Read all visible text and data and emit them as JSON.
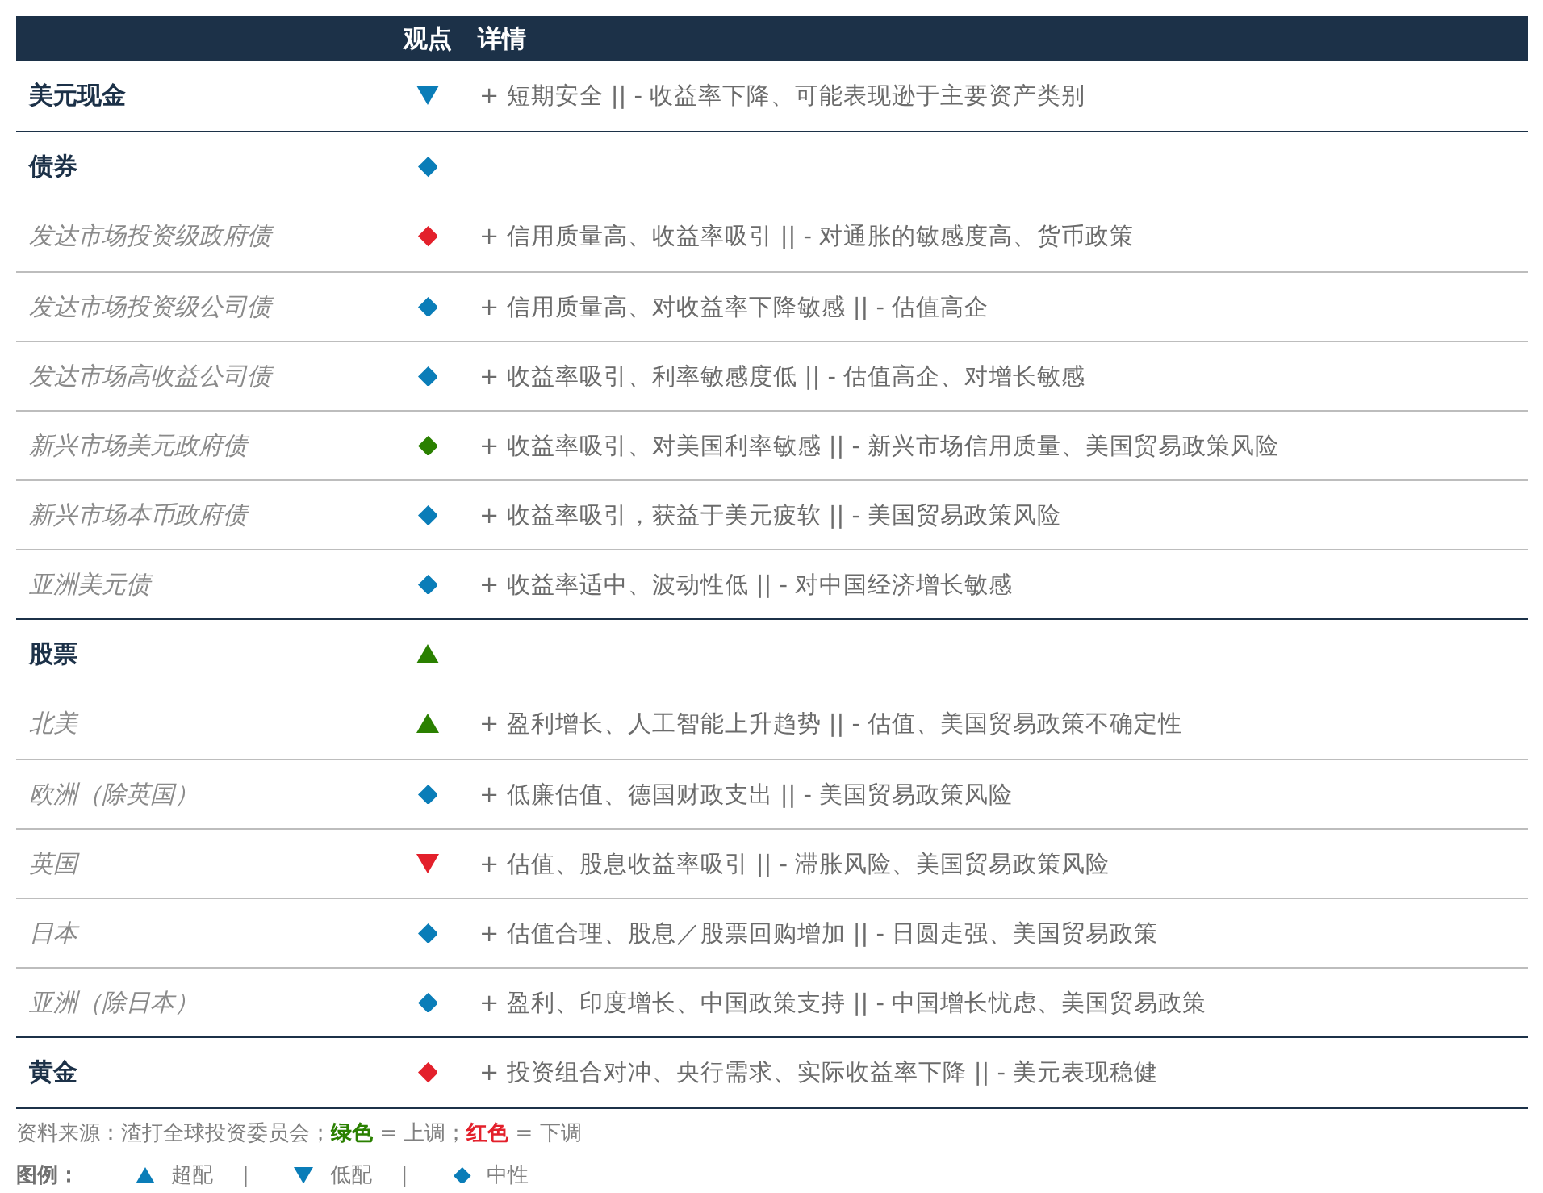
{
  "header": {
    "column_2": "观点",
    "column_3": "详情"
  },
  "sections": [
    {
      "name": "美元现金",
      "view": {
        "kind": "down",
        "color": "#0a7db8"
      },
      "details": "+ 短期安全 || - 收益率下降、可能表现逊于主要资产类别"
    },
    {
      "name": "债券",
      "view": {
        "kind": "diamond",
        "color": "#0a7db8"
      },
      "items": [
        {
          "name": "发达市场投资级政府债",
          "view": {
            "kind": "diamond",
            "color": "#e3202b"
          },
          "details": "+ 信用质量高、收益率吸引 || - 对通胀的敏感度高、货币政策"
        },
        {
          "name": "发达市场投资级公司债",
          "view": {
            "kind": "diamond",
            "color": "#0a7db8"
          },
          "details": "+ 信用质量高、对收益率下降敏感 || - 估值高企"
        },
        {
          "name": "发达市场高收益公司债",
          "view": {
            "kind": "diamond",
            "color": "#0a7db8"
          },
          "details": "+ 收益率吸引、利率敏感度低 || - 估值高企、对增长敏感"
        },
        {
          "name": "新兴市场美元政府债",
          "view": {
            "kind": "diamond",
            "color": "#2a8000"
          },
          "details": "+ 收益率吸引、对美国利率敏感 || - 新兴市场信用质量、美国贸易政策风险"
        },
        {
          "name": "新兴市场本币政府债",
          "view": {
            "kind": "diamond",
            "color": "#0a7db8"
          },
          "details": "+ 收益率吸引，获益于美元疲软 || - 美国贸易政策风险"
        },
        {
          "name": "亚洲美元债",
          "view": {
            "kind": "diamond",
            "color": "#0a7db8"
          },
          "details": "+ 收益率适中、波动性低 || - 对中国经济增长敏感"
        }
      ]
    },
    {
      "name": "股票",
      "view": {
        "kind": "up",
        "color": "#2a8000"
      },
      "items": [
        {
          "name": "北美",
          "view": {
            "kind": "up",
            "color": "#2a8000"
          },
          "details": "+ 盈利增长、人工智能上升趋势 || - 估值、美国贸易政策不确定性"
        },
        {
          "name": "欧洲（除英国）",
          "view": {
            "kind": "diamond",
            "color": "#0a7db8"
          },
          "details": "+ 低廉估值、德国财政支出 || - 美国贸易政策风险"
        },
        {
          "name": "英国",
          "view": {
            "kind": "down",
            "color": "#e3202b"
          },
          "details": "+ 估值、股息收益率吸引 || - 滞胀风险、美国贸易政策风险"
        },
        {
          "name": "日本",
          "view": {
            "kind": "diamond",
            "color": "#0a7db8"
          },
          "details": "+ 估值合理、股息／股票回购增加 || - 日圆走强、美国贸易政策"
        },
        {
          "name": "亚洲（除日本）",
          "view": {
            "kind": "diamond",
            "color": "#0a7db8"
          },
          "details": "+ 盈利、印度增长、中国政策支持 || - 中国增长忧虑、美国贸易政策"
        }
      ]
    },
    {
      "name": "黄金",
      "view": {
        "kind": "diamond",
        "color": "#e3202b"
      },
      "details": "+ 投资组合对冲、央行需求、实际收益率下降 || - 美元表现稳健"
    }
  ],
  "source_note": [
    {
      "text": "资料来源：渣打全球投资委员会；"
    },
    {
      "text": "绿色",
      "color": "#2a8000"
    },
    {
      "text": " = 上调；"
    },
    {
      "text": "红色",
      "color": "#e3202b"
    },
    {
      "text": " = 下调"
    }
  ],
  "legend": {
    "title": "图例：",
    "entries": [
      {
        "kind": "up",
        "color": "#0a7db8",
        "label": "超配"
      },
      {
        "kind": "separator",
        "label": "|"
      },
      {
        "kind": "down",
        "color": "#0a7db8",
        "label": "低配"
      },
      {
        "kind": "separator",
        "label": "|"
      },
      {
        "kind": "diamond",
        "color": "#0a7db8",
        "label": "中性"
      }
    ]
  }
}
